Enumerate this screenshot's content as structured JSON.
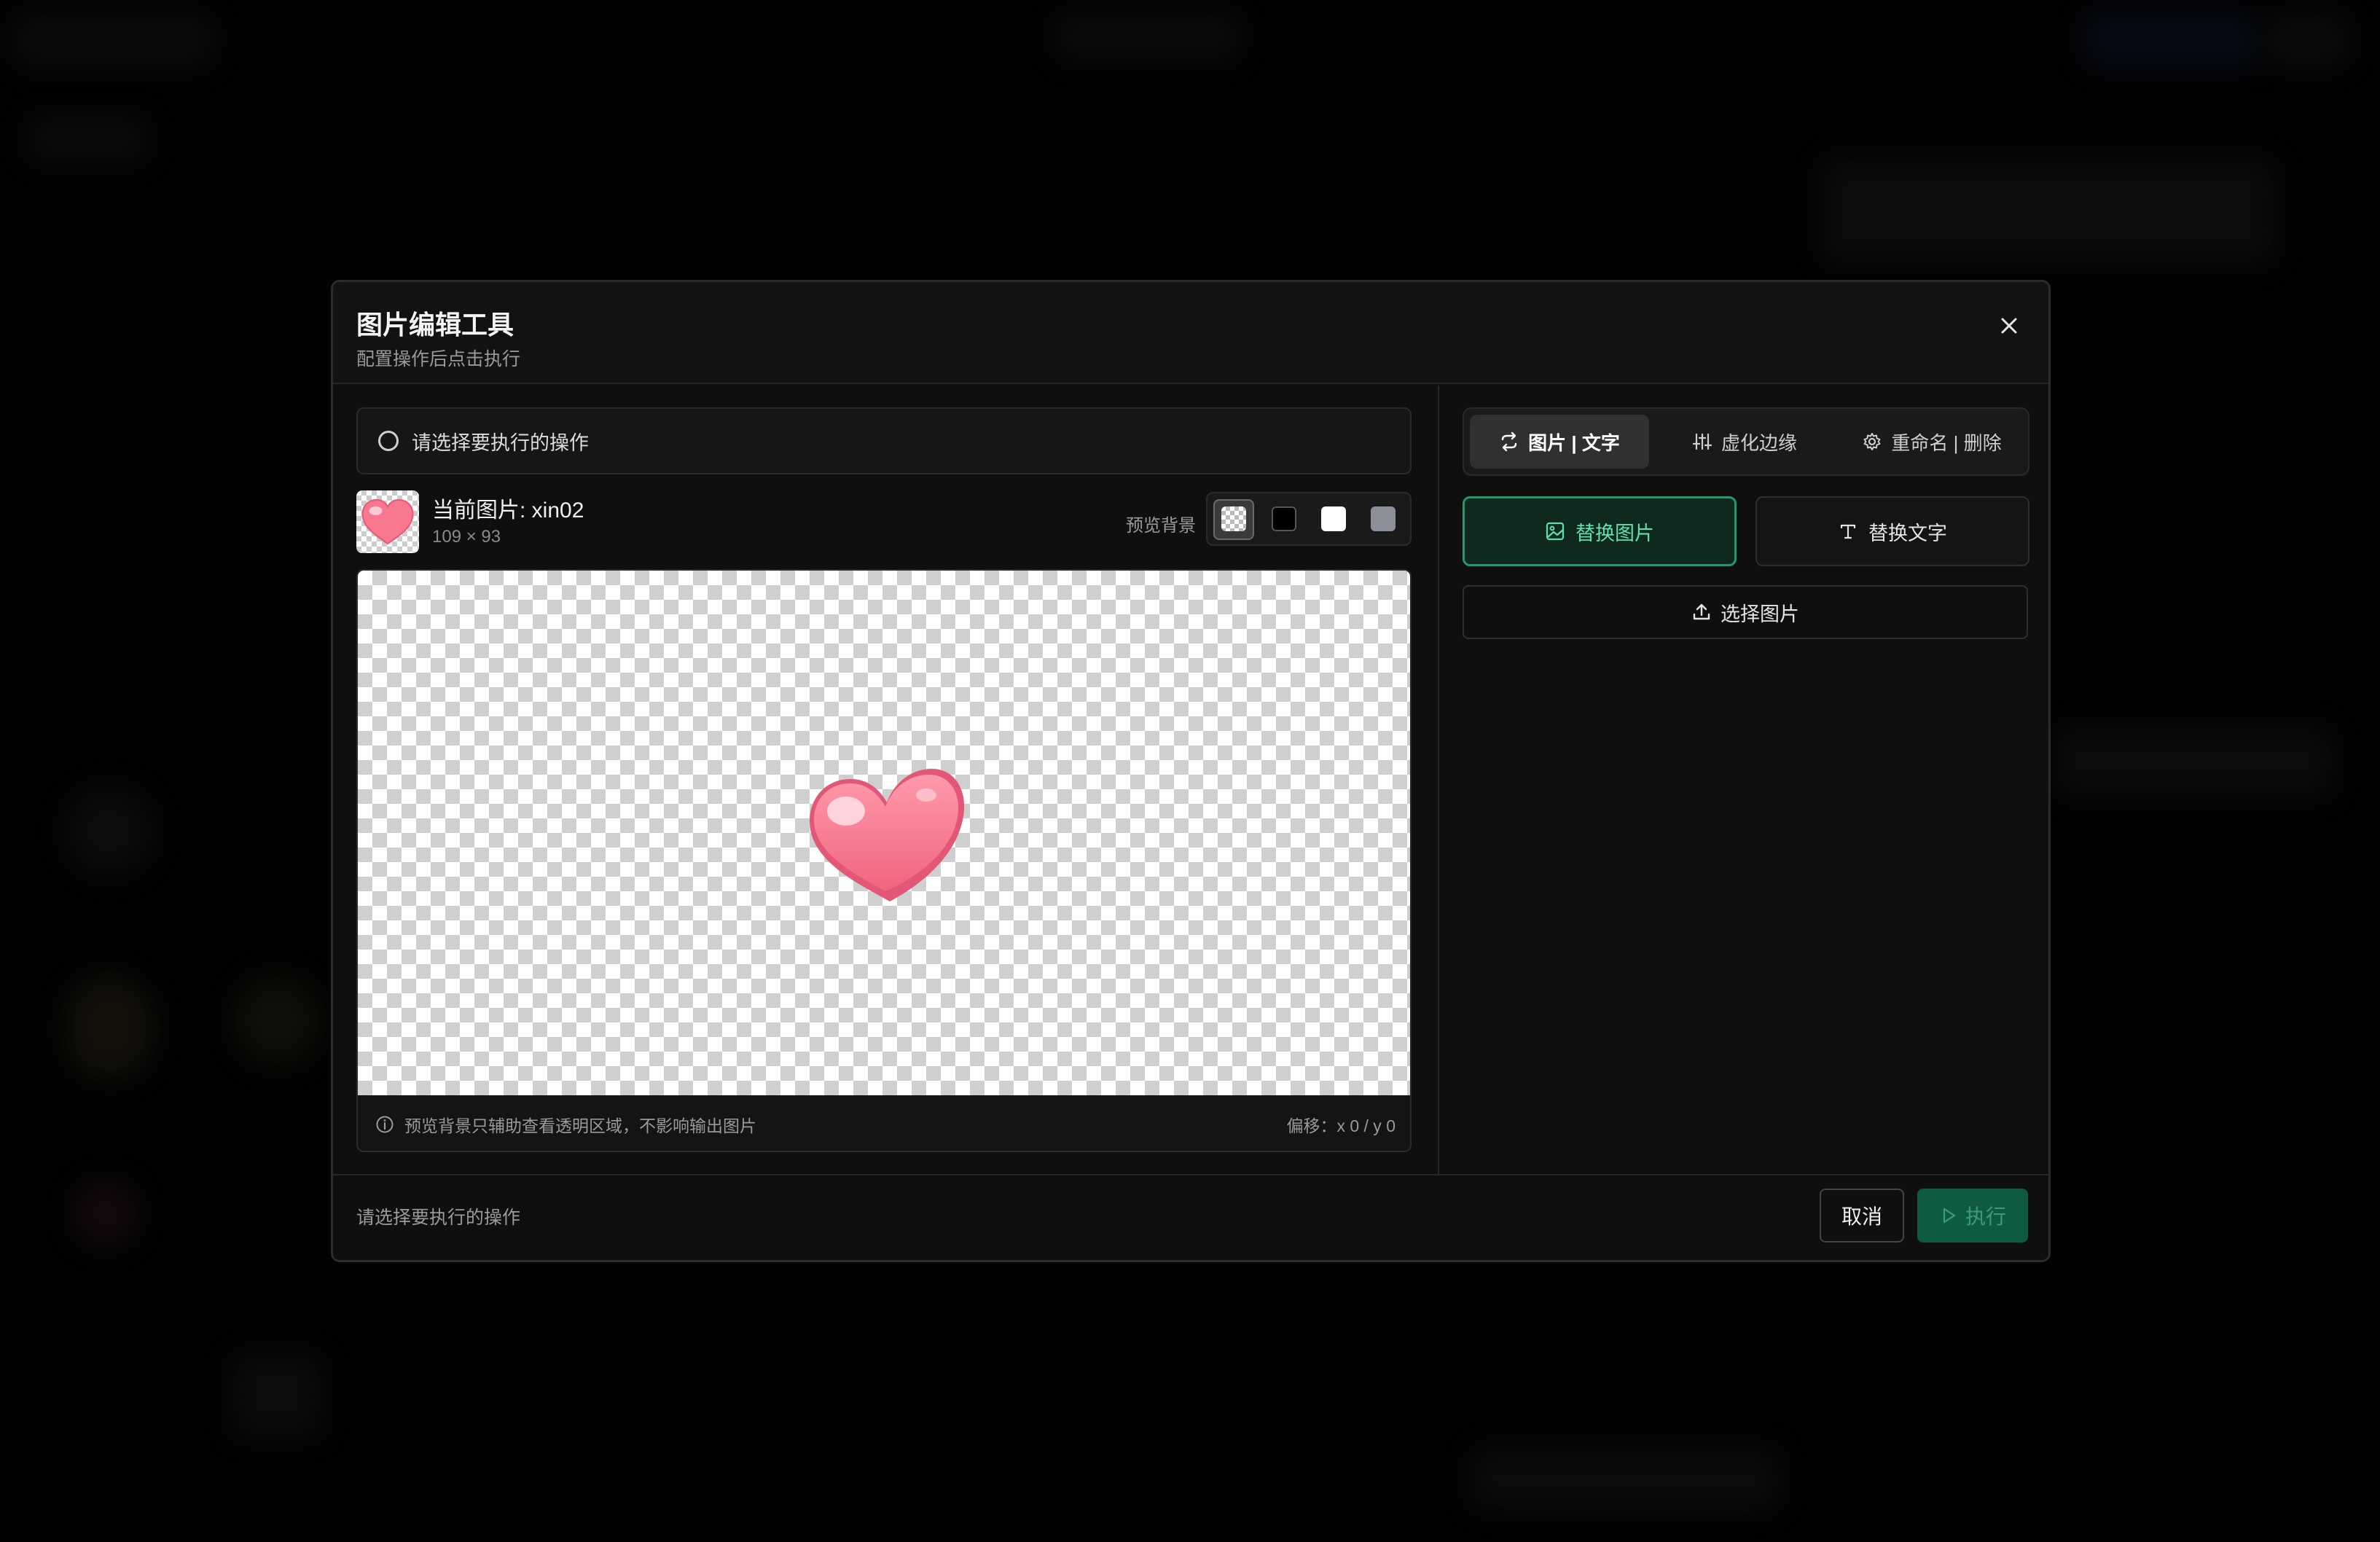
{
  "modal": {
    "title": "图片编辑工具",
    "subtitle": "配置操作后点击执行"
  },
  "operation_select": {
    "placeholder": "请选择要执行的操作"
  },
  "current_image": {
    "label": "当前图片: xin02",
    "dimensions": "109 × 93"
  },
  "preview_background": {
    "label": "预览背景",
    "options": [
      "checkerboard",
      "black",
      "white",
      "gray"
    ],
    "selected": "checkerboard"
  },
  "preview": {
    "note": "预览背景只辅助查看透明区域，不影响输出图片",
    "offset": "偏移：x 0 / y 0"
  },
  "tabs": [
    {
      "label": "图片 | 文字",
      "icon": "swap-icon",
      "active": true
    },
    {
      "label": "虚化边缘",
      "icon": "sliders-icon",
      "active": false
    },
    {
      "label": "重命名 | 删除",
      "icon": "gear-icon",
      "active": false
    }
  ],
  "mode_buttons": {
    "replace_image": "替换图片",
    "replace_text": "替换文字",
    "selected": "replace_image"
  },
  "choose_image": "选择图片",
  "footer": {
    "status": "请选择要执行的操作",
    "cancel": "取消",
    "execute": "执行"
  },
  "colors": {
    "accent": "#1f9a6b",
    "accent_text": "#5fe0ad",
    "execute_bg": "#0f5b41",
    "heart": "#f7788f"
  }
}
